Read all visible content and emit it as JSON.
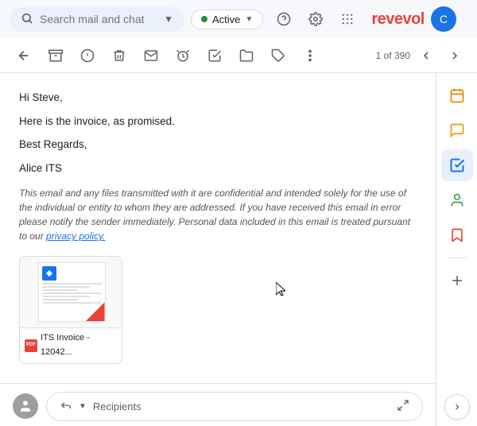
{
  "topbar": {
    "search_placeholder": "Search mail and chat",
    "search_dropdown_icon": "▼",
    "active_label": "Active",
    "active_dropdown": "▼",
    "help_icon": "?",
    "settings_icon": "⚙",
    "apps_icon": "⠿",
    "brand_name": "revevol",
    "avatar_letter": "C"
  },
  "toolbar": {
    "back_icon": "←",
    "archive_icon": "▦",
    "spam_icon": "ⓘ",
    "delete_icon": "🗑",
    "email_icon": "✉",
    "time_icon": "⏰",
    "edit_icon": "✎",
    "folder_icon": "📁",
    "tag_icon": "🏷",
    "more_icon": "⋮",
    "page_indicator": "1 of 390",
    "prev_icon": "‹",
    "next_icon": "›"
  },
  "email": {
    "greeting": "Hi Steve,",
    "line1": "Here is the invoice, as promised.",
    "closing": "Best Regards,",
    "signature": "Alice ITS",
    "disclaimer": "This email and any files transmitted with it are confidential and intended solely for the use of the individual or entity to whom they are addressed. If you have received this email in error please notify the sender immediately. Personal data included in this email is treated pursuant to our",
    "privacy_link_text": "privacy policy.",
    "attachment": {
      "label": "ITS Invoice - 12042...",
      "type": "PDF"
    }
  },
  "reply": {
    "avatar_icon": "👤",
    "forward_icon": "↩",
    "recipients_placeholder": "Recipients",
    "expand_icon": "⤢"
  },
  "sidebar": {
    "calendar_icon": "📅",
    "chat_icon": "💬",
    "tasks_icon": "✓",
    "contacts_icon": "👤",
    "bookmark_icon": "🔖",
    "add_icon": "+",
    "arrow_icon": "›"
  }
}
